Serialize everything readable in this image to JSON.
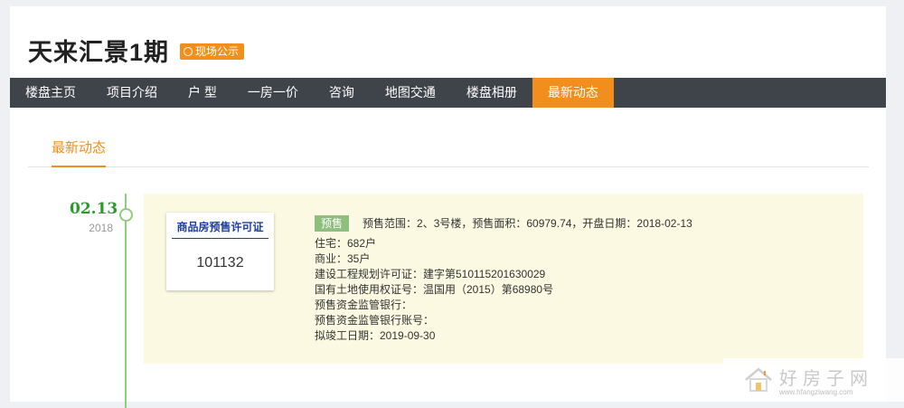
{
  "project": {
    "title": "天来汇景1期",
    "badge": "现场公示"
  },
  "nav": {
    "items": [
      {
        "label": "楼盘主页"
      },
      {
        "label": "项目介绍"
      },
      {
        "label": "户 型"
      },
      {
        "label": "一房一价"
      },
      {
        "label": "咨询"
      },
      {
        "label": "地图交通"
      },
      {
        "label": "楼盘相册"
      },
      {
        "label": "最新动态"
      }
    ],
    "active_index": 7
  },
  "section": {
    "tab": "最新动态"
  },
  "event": {
    "date": "02.13",
    "year": "2018",
    "license": {
      "title": "商品房预售许可证",
      "number": "101132"
    },
    "tag": "预售",
    "summary": "预售范围：2、3号楼，预售面积：60979.74，开盘日期：2018-02-13",
    "lines": [
      "住宅：682户",
      "商业：35户",
      "建设工程规划许可证：建字第510115201630029",
      "国有土地使用权证号：温国用（2015）第68980号",
      "预售资金监管银行：",
      "预售资金监管银行账号：",
      "拟竣工日期：2019-09-30"
    ]
  },
  "watermark": {
    "name": "好房子网",
    "url": "www.hfangziwang.com"
  },
  "colors": {
    "accent": "#f28e1c",
    "nav_bg": "#3f434a",
    "timeline": "#8fce7c",
    "event_bg": "#fbf9e1",
    "date": "#2b9a2b",
    "license_blue": "#1e3fa0"
  }
}
